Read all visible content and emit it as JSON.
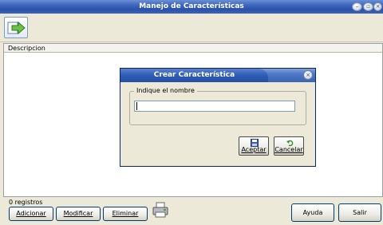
{
  "window": {
    "title": "Manejo de Características"
  },
  "toolbar": {
    "action_icon": "arrow-right-icon"
  },
  "grid": {
    "column_header": "Descripcion"
  },
  "status": {
    "record_count": "0 registros"
  },
  "buttons": {
    "add": "Adicionar",
    "modify": "Modificar",
    "delete": "Eliminar",
    "help": "Ayuda",
    "exit": "Salir"
  },
  "dialog": {
    "title": "Crear Característica",
    "group_label": "Indique el nombre",
    "name_value": "",
    "accept": "Aceptar",
    "cancel": "Cancelar"
  },
  "colors": {
    "titlebar": "#2b52aa",
    "dialog_border": "#0a246a",
    "window_bg": "#ece9d8"
  }
}
